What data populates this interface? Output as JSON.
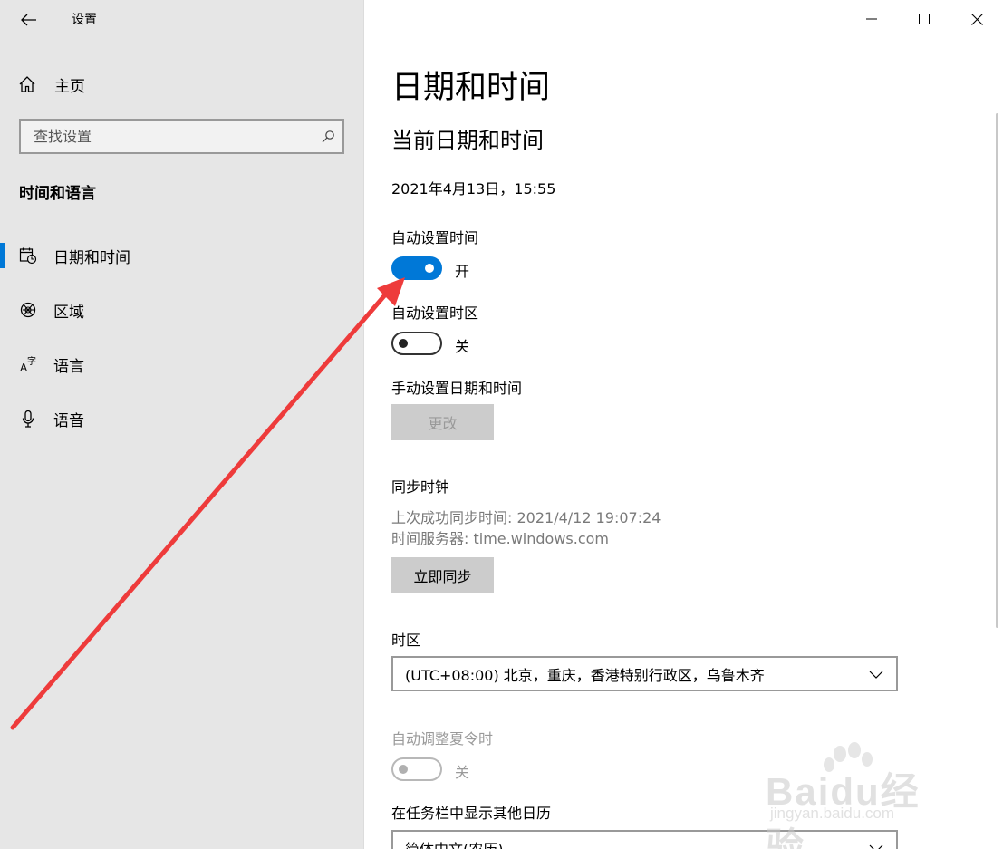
{
  "window": {
    "app_title": "设置",
    "controls": [
      "minimize-icon",
      "maximize-icon",
      "close-icon"
    ]
  },
  "sidebar": {
    "home_label": "主页",
    "search_placeholder": "查找设置",
    "section_title": "时间和语言",
    "items": [
      {
        "label": "日期和时间",
        "icon": "calendar-clock-icon",
        "active": true
      },
      {
        "label": "区域",
        "icon": "globe-icon",
        "active": false
      },
      {
        "label": "语言",
        "icon": "language-icon",
        "active": false
      },
      {
        "label": "语音",
        "icon": "microphone-icon",
        "active": false
      }
    ]
  },
  "main": {
    "page_title": "日期和时间",
    "subtitle": "当前日期和时间",
    "current_datetime": "2021年4月13日，15:55",
    "auto_time": {
      "label": "自动设置时间",
      "state": "开",
      "on": true
    },
    "auto_timezone": {
      "label": "自动设置时区",
      "state": "关",
      "on": false
    },
    "manual": {
      "label": "手动设置日期和时间",
      "button": "更改"
    },
    "sync": {
      "label": "同步时钟",
      "last_sync": "上次成功同步时间: 2021/4/12 19:07:24",
      "server": "时间服务器: time.windows.com",
      "button": "立即同步"
    },
    "timezone": {
      "label": "时区",
      "value": "(UTC+08:00) 北京，重庆，香港特别行政区，乌鲁木齐"
    },
    "dst": {
      "label": "自动调整夏令时",
      "state": "关",
      "on": false,
      "disabled": true
    },
    "calendar": {
      "label": "在任务栏中显示其他日历",
      "value": "简体中文(农历)"
    }
  },
  "watermark": {
    "main": "Baidu经验",
    "sub": "jingyan.baidu.com"
  },
  "colors": {
    "accent": "#0078d7",
    "annotation_arrow": "#ee3b3b",
    "sidebar_bg": "#e6e6e6"
  }
}
